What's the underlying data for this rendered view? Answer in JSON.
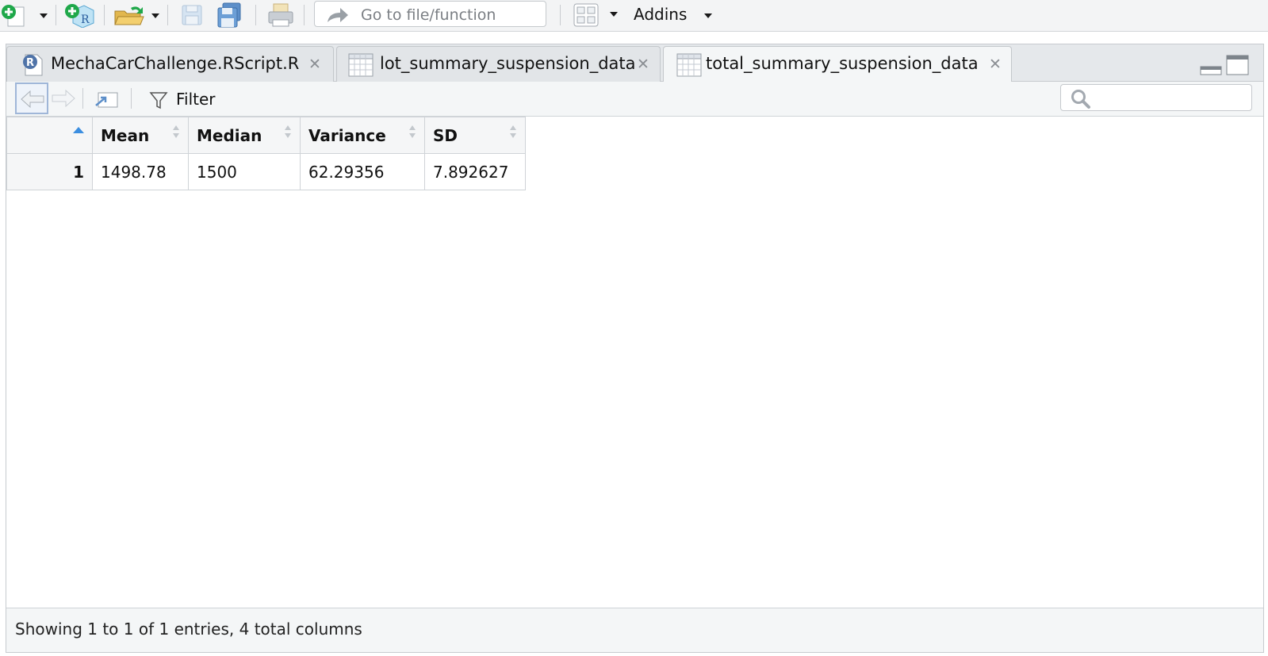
{
  "toolbar": {
    "goto_placeholder": "Go to file/function",
    "addins_label": "Addins"
  },
  "tabs": [
    {
      "label": "MechaCarChallenge.RScript.R",
      "icon": "r-script-icon",
      "active": false
    },
    {
      "label": "lot_summary_suspension_data",
      "icon": "table-icon",
      "active": false
    },
    {
      "label": "total_summary_suspension_data",
      "icon": "table-icon",
      "active": true
    }
  ],
  "viewer": {
    "filter_label": "Filter",
    "columns": [
      "Mean",
      "Median",
      "Variance",
      "SD"
    ],
    "rows": [
      {
        "row": "1",
        "cells": [
          "1498.78",
          "1500",
          "62.29356",
          "7.892627"
        ]
      }
    ],
    "status": "Showing 1 to 1 of 1 entries, 4 total columns"
  },
  "colors": {
    "sort_active": "#3b8ee0",
    "new_file_green": "#1fa84a"
  }
}
